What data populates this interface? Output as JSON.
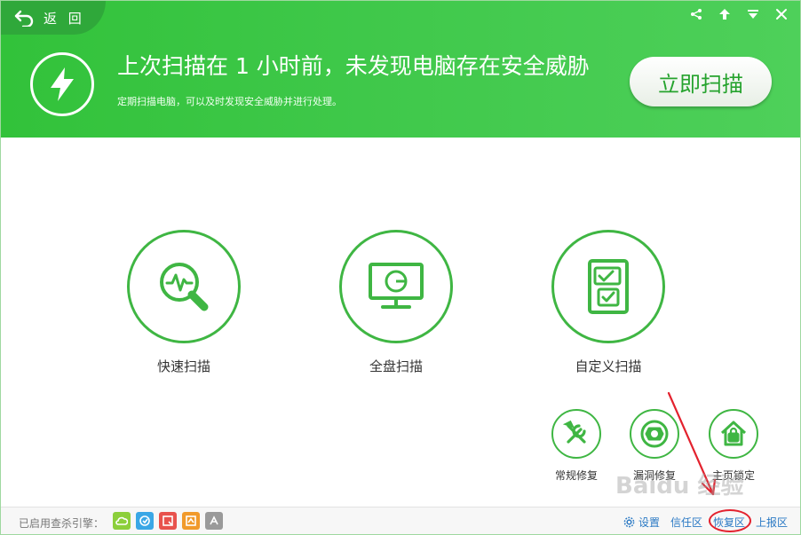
{
  "header": {
    "back_label": "返 回",
    "headline": "上次扫描在 1 小时前，未发现电脑存在安全威胁",
    "subline": "定期扫描电脑，可以及时发现安全威胁并进行处理。",
    "scan_button": "立即扫描",
    "window_controls": [
      "share-icon",
      "upload-icon",
      "menu-icon",
      "close-icon"
    ]
  },
  "options": [
    {
      "label": "快速扫描",
      "icon": "waveform-magnifier-icon"
    },
    {
      "label": "全盘扫描",
      "icon": "monitor-icon"
    },
    {
      "label": "自定义扫描",
      "icon": "checklist-icon"
    }
  ],
  "tools": [
    {
      "label": "常规修复",
      "icon": "wrench-screwdriver-icon"
    },
    {
      "label": "漏洞修复",
      "icon": "shield-patch-icon"
    },
    {
      "label": "主页锁定",
      "icon": "home-lock-icon"
    }
  ],
  "footer": {
    "engines_label": "已启用查杀引擎：",
    "engines": [
      {
        "icon": "cloud-engine-icon",
        "color": "#8ccf3b"
      },
      {
        "icon": "sync-engine-icon",
        "color": "#3aa7e6"
      },
      {
        "icon": "qvm-engine-icon",
        "color": "#e8524d"
      },
      {
        "icon": "system-engine-icon",
        "color": "#f19a2b"
      },
      {
        "icon": "avira-engine-icon",
        "color": "#9a9a9a"
      }
    ],
    "links": {
      "settings": "设置",
      "trust": "信任区",
      "restore": "恢复区",
      "report": "上报区"
    }
  },
  "watermark": "Baidu 经验",
  "colors": {
    "brand_green": "#3fc84a",
    "ring_green": "#3fb643",
    "link_blue": "#2a79c4",
    "annotation_red": "#e3222e"
  }
}
